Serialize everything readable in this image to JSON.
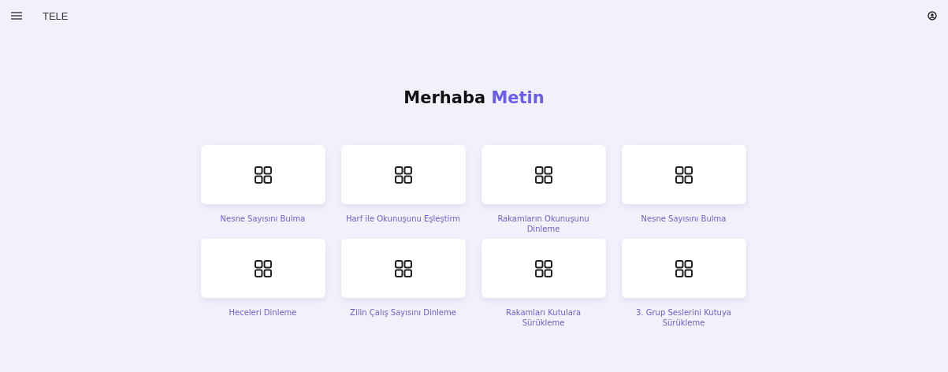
{
  "app_bar": {
    "title": "TELE"
  },
  "greeting": {
    "text": "Merhaba",
    "name": "Metin"
  },
  "activities": [
    {
      "label": "Nesne Sayısını Bulma"
    },
    {
      "label": "Harf ile Okunuşunu Eşleştirm"
    },
    {
      "label": "Rakamların Okunuşunu Dinleme"
    },
    {
      "label": "Nesne Sayısını Bulma"
    },
    {
      "label": "Heceleri Dinleme"
    },
    {
      "label": "Zilin Çalış Sayısını Dinleme"
    },
    {
      "label": "Rakamları Kutulara Sürükleme"
    },
    {
      "label": "3. Grup Seslerini Kutuya Sürükleme"
    }
  ]
}
